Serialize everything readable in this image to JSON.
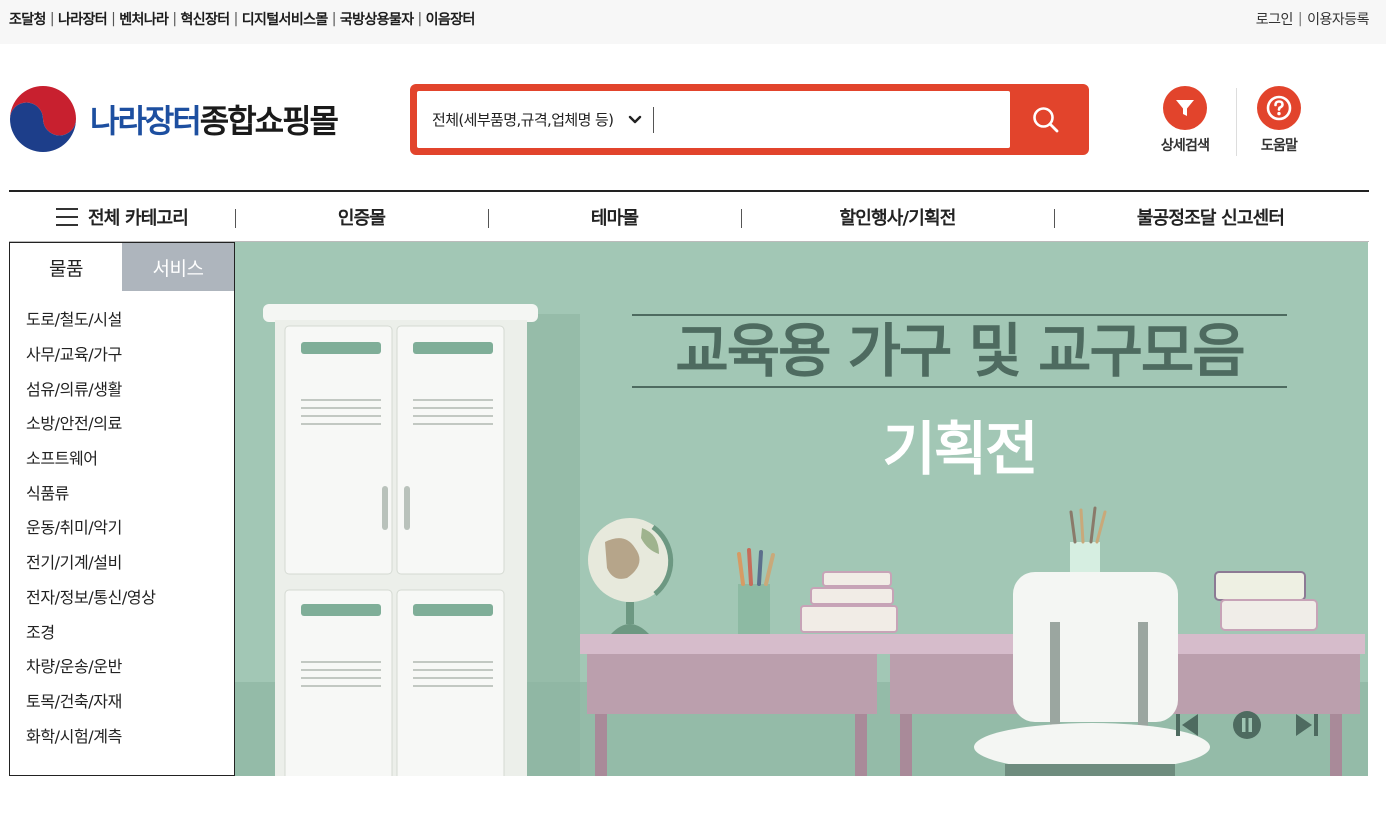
{
  "top_bar": {
    "sites": [
      "조달청",
      "나라장터",
      "벤처나라",
      "혁신장터",
      "디지털서비스몰",
      "국방상용물자",
      "이음장터"
    ],
    "login": "로그인",
    "register": "이용자등록"
  },
  "header": {
    "logo_blue": "나라장터",
    "logo_dark": "종합쇼핑몰",
    "search_scope": "전체(세부품명,규격,업체명 등)",
    "search_value": "",
    "tools": [
      {
        "label": "상세검색",
        "icon": "filter-icon"
      },
      {
        "label": "도움말",
        "icon": "help-icon"
      }
    ]
  },
  "nav": {
    "all_categories": "전체 카테고리",
    "items": [
      "인증몰",
      "테마몰",
      "할인행사/기획전",
      "불공정조달 신고센터"
    ]
  },
  "category_panel": {
    "tabs": [
      "물품",
      "서비스"
    ],
    "active_tab": "물품",
    "items": [
      "도로/철도/시설",
      "사무/교육/가구",
      "섬유/의류/생활",
      "소방/안전/의료",
      "소프트웨어",
      "식품류",
      "운동/취미/악기",
      "전기/기계/설비",
      "전자/정보/통신/영상",
      "조경",
      "차량/운송/운반",
      "토목/건축/자재",
      "화학/시험/계측"
    ]
  },
  "banner": {
    "title": "교육용 가구 및 교구모음",
    "subtitle": "기획전",
    "controls": [
      "previous-icon",
      "pause-icon",
      "next-icon"
    ]
  },
  "colors": {
    "accent": "#e2442c",
    "brand_blue": "#1d4fa0",
    "banner_bg": "#9fc5b3",
    "banner_title": "#4e6b60",
    "tab_inactive": "#aeb5bd"
  }
}
